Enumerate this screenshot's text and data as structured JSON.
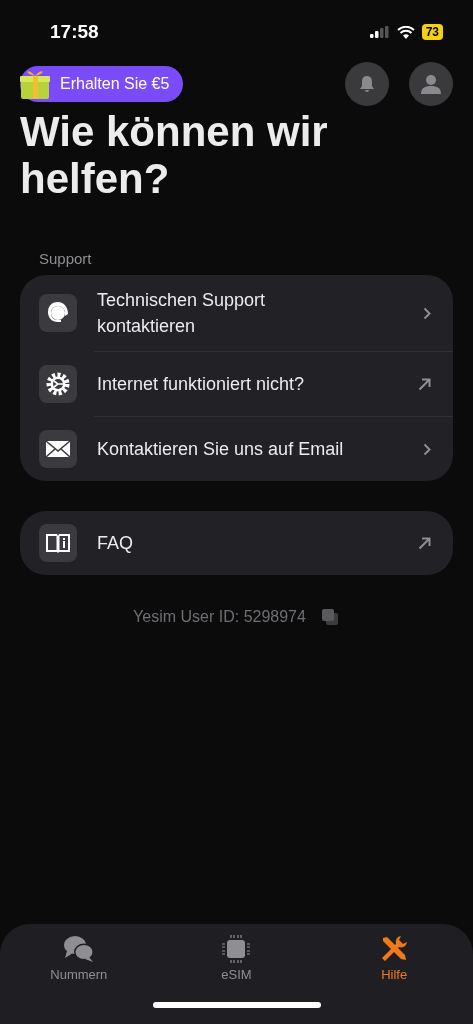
{
  "status_bar": {
    "time": "17:58",
    "battery": "73"
  },
  "promo": {
    "label": "Erhalten Sie €5"
  },
  "title": "Wie können wir helfen?",
  "support": {
    "heading": "Support",
    "items": [
      {
        "label": "Technischen Support kontaktieren"
      },
      {
        "label": "Internet funktioniert nicht?"
      },
      {
        "label": "Kontaktieren Sie uns auf Email"
      }
    ]
  },
  "faq": {
    "label": "FAQ"
  },
  "user_id": "Yesim User ID: 5298974",
  "tab_bar": [
    {
      "label": "Nummern",
      "selected": false
    },
    {
      "label": "eSIM",
      "selected": false
    },
    {
      "label": "Hilfe",
      "selected": true
    }
  ]
}
